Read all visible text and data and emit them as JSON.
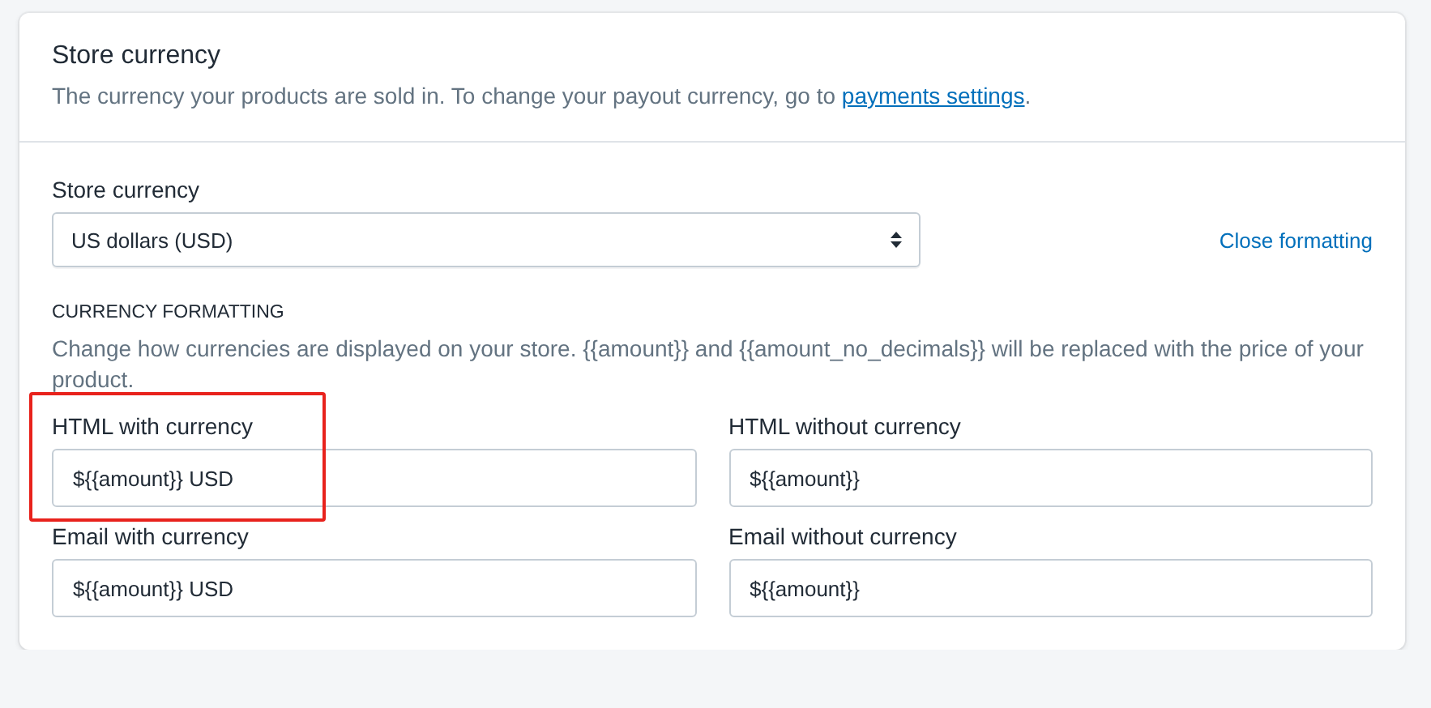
{
  "header": {
    "title": "Store currency",
    "description": "The currency your products are sold in. To change your payout currency, go to ",
    "link": "payments settings",
    "description_end": "."
  },
  "currency_select": {
    "label": "Store currency",
    "value": "US dollars (USD)"
  },
  "close_link": "Close formatting",
  "formatting": {
    "heading": "CURRENCY FORMATTING",
    "description": "Change how currencies are displayed on your store. {{amount}} and {{amount_no_decimals}} will be replaced with the price of your product."
  },
  "fields": [
    {
      "label": "HTML with currency",
      "value": "${{amount}} USD",
      "highlighted": true
    },
    {
      "label": "HTML without currency",
      "value": "${{amount}}",
      "highlighted": false
    },
    {
      "label": "Email with currency",
      "value": "${{amount}} USD",
      "highlighted": false
    },
    {
      "label": "Email without currency",
      "value": "${{amount}}",
      "highlighted": false
    }
  ]
}
